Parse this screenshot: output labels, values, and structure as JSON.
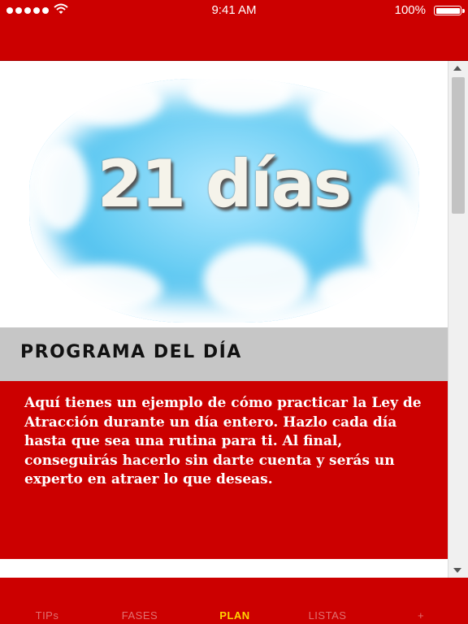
{
  "status_bar": {
    "time": "9:41 AM",
    "battery": "100%"
  },
  "hero": {
    "title": "21 días"
  },
  "section": {
    "title": "PROGRAMA DEL DÍA",
    "body": "Aquí tienes un ejemplo de cómo practicar la Ley de Atracción durante un día entero. Hazlo cada día hasta que sea una rutina para ti. Al final, conseguirás hacerlo sin darte cuenta y serás un experto en atraer lo que deseas."
  },
  "tabs": [
    {
      "label": "TIPs",
      "active": false
    },
    {
      "label": "FASES",
      "active": false
    },
    {
      "label": "PLAN",
      "active": true
    },
    {
      "label": "LISTAS",
      "active": false
    },
    {
      "label": "+",
      "active": false
    }
  ],
  "colors": {
    "primary_red": "#cc0000",
    "active_tab": "#ffd400",
    "inactive_tab": "#e07070",
    "section_header_bg": "#c6c6c6"
  },
  "icons": [
    "signal-dots-icon",
    "wifi-icon",
    "battery-icon",
    "scroll-up-arrow-icon",
    "scroll-down-arrow-icon"
  ]
}
